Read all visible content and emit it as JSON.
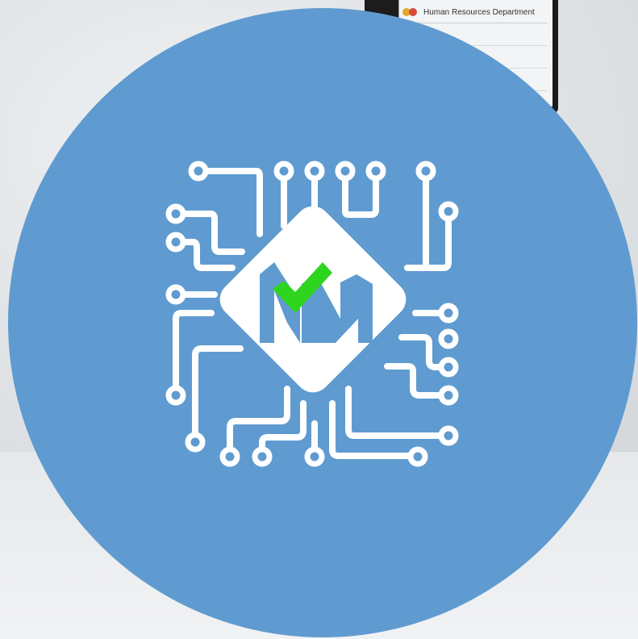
{
  "screen": {
    "menu_item_label": "Human Resources Department"
  },
  "logo": {
    "text": "MN",
    "circle_color": "#5f9bd0",
    "check_color": "#2fd41f",
    "letter_color": "#5f9bd0",
    "circuit_color": "#ffffff"
  }
}
